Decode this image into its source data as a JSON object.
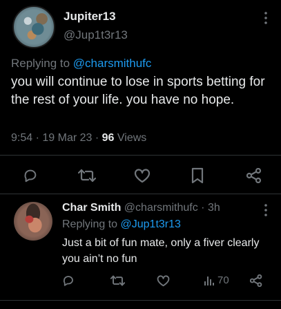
{
  "main_tweet": {
    "author_name": "Jupiter13",
    "author_handle": "@Jup1t3r13",
    "replying_prefix": "Replying to ",
    "replying_handle": "@charsmithufc",
    "text": "you will continue to lose in sports betting for the rest of your life. you have no hope.",
    "time": "9:54",
    "date": "19 Mar 23",
    "views_count": "96",
    "views_label": " Views",
    "actions": [
      "reply-icon",
      "retweet-icon",
      "like-icon",
      "bookmark-icon",
      "share-icon"
    ]
  },
  "reply_tweet": {
    "author_name": "Char Smith",
    "author_handle": "@charsmithufc",
    "time_ago": "3h",
    "replying_prefix": "Replying to ",
    "replying_handle": "@Jup1t3r13",
    "text": "Just a bit of fun mate, only a fiver clearly you ain’t no fun",
    "views_count": "70",
    "actions": [
      "reply-icon",
      "retweet-icon",
      "like-icon",
      "views-icon",
      "share-icon"
    ]
  },
  "colors": {
    "background": "#000000",
    "text": "#e7e9ea",
    "muted": "#71767b",
    "link": "#1d9bf0",
    "divider": "#2f3336"
  }
}
